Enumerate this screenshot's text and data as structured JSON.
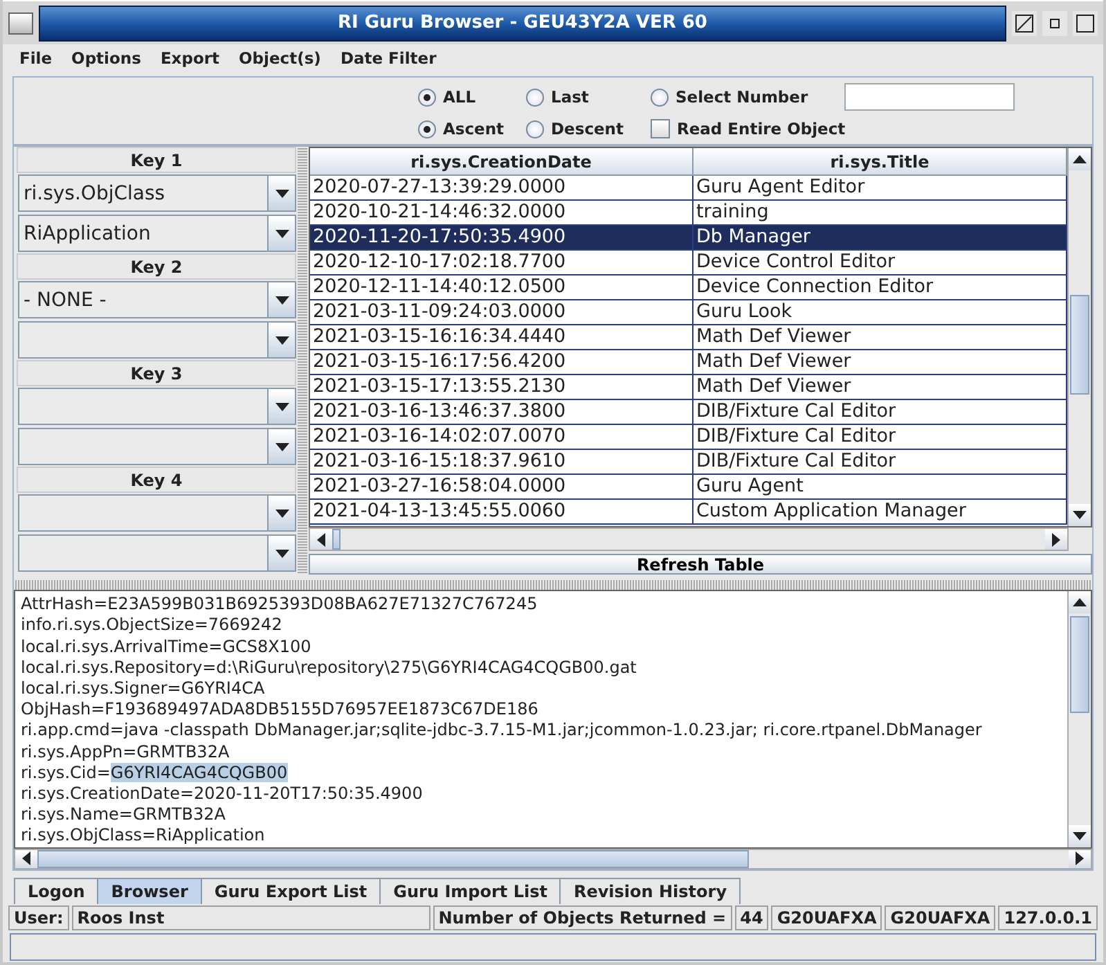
{
  "window": {
    "title": "RI Guru Browser - GEU43Y2A  VER 60"
  },
  "menu": [
    "File",
    "Options",
    "Export",
    "Object(s)",
    "Date Filter"
  ],
  "options": {
    "count_radios": [
      {
        "label": "ALL",
        "selected": true
      },
      {
        "label": "Last",
        "selected": false
      },
      {
        "label": "Select Number",
        "selected": false
      }
    ],
    "order_radios": [
      {
        "label": "Ascent",
        "selected": true
      },
      {
        "label": "Descent",
        "selected": false
      }
    ],
    "read_entire": {
      "label": "Read Entire Object",
      "checked": false
    }
  },
  "keys": [
    {
      "label": "Key 1",
      "fields": [
        {
          "kind": "combo",
          "value": "ri.sys.ObjClass"
        },
        {
          "kind": "combo",
          "value": "RiApplication"
        }
      ]
    },
    {
      "label": "Key 2",
      "fields": [
        {
          "kind": "combo",
          "value": "- NONE -"
        },
        {
          "kind": "combo"
        }
      ]
    },
    {
      "label": "Key 3",
      "fields": [
        {
          "kind": "combo"
        },
        {
          "kind": "combo"
        }
      ]
    },
    {
      "label": "Key 4",
      "fields": [
        {
          "kind": "combo"
        },
        {
          "kind": "combo"
        }
      ]
    }
  ],
  "table": {
    "columns": [
      "ri.sys.CreationDate",
      "ri.sys.Title"
    ],
    "rows": [
      {
        "date": "2020-07-27-13:39:29.0000",
        "title": "Guru Agent Editor",
        "selected": false
      },
      {
        "date": "2020-10-21-14:46:32.0000",
        "title": "training",
        "selected": false
      },
      {
        "date": "2020-11-20-17:50:35.4900",
        "title": "Db Manager",
        "selected": true
      },
      {
        "date": "2020-12-10-17:02:18.7700",
        "title": "Device Control Editor",
        "selected": false
      },
      {
        "date": "2020-12-11-14:40:12.0500",
        "title": "Device Connection Editor",
        "selected": false
      },
      {
        "date": "2021-03-11-09:24:03.0000",
        "title": "Guru Look",
        "selected": false
      },
      {
        "date": "2021-03-15-16:16:34.4440",
        "title": "Math Def Viewer",
        "selected": false
      },
      {
        "date": "2021-03-15-16:17:56.4200",
        "title": "Math Def Viewer",
        "selected": false
      },
      {
        "date": "2021-03-15-17:13:55.2130",
        "title": "Math Def Viewer",
        "selected": false
      },
      {
        "date": "2021-03-16-13:46:37.3800",
        "title": "DIB/Fixture Cal Editor",
        "selected": false
      },
      {
        "date": "2021-03-16-14:02:07.0070",
        "title": "DIB/Fixture Cal Editor",
        "selected": false
      },
      {
        "date": "2021-03-16-15:18:37.9610",
        "title": "DIB/Fixture Cal Editor",
        "selected": false
      },
      {
        "date": "2021-03-27-16:58:04.0000",
        "title": "Guru Agent",
        "selected": false
      },
      {
        "date": "2021-04-13-13:45:55.0060",
        "title": "Custom Application Manager",
        "selected": false
      }
    ]
  },
  "refresh_button": "Refresh Table",
  "details": [
    {
      "text": "AttrHash=E23A599B031B6925393D08BA627E71327C767245"
    },
    {
      "text": "info.ri.sys.ObjectSize=7669242"
    },
    {
      "text": "local.ri.sys.ArrivalTime=GCS8X100"
    },
    {
      "text": "local.ri.sys.Repository=d:\\RiGuru\\repository\\275\\G6YRI4CAG4CQGB00.gat"
    },
    {
      "text": "local.ri.sys.Signer=G6YRI4CA"
    },
    {
      "text": "ObjHash=F193689497ADA8DB5155D76957EE1873C67DE186"
    },
    {
      "text": "ri.app.cmd=java -classpath DbManager.jar;sqlite-jdbc-3.7.15-M1.jar;jcommon-1.0.23.jar;  ri.core.rtpanel.DbManager"
    },
    {
      "text": "ri.sys.AppPn=GRMTB32A"
    },
    {
      "text": "ri.sys.Cid=",
      "highlight": "G6YRI4CAG4CQGB00"
    },
    {
      "text": "ri.sys.CreationDate=2020-11-20T17:50:35.4900"
    },
    {
      "text": "ri.sys.Name=GRMTB32A"
    },
    {
      "text": "ri.sys.ObjClass=RiApplication"
    }
  ],
  "tabs": [
    {
      "label": "Logon",
      "selected": false
    },
    {
      "label": "Browser",
      "selected": true
    },
    {
      "label": "Guru Export List",
      "selected": false
    },
    {
      "label": "Guru Import List",
      "selected": false
    },
    {
      "label": "Revision History",
      "selected": false
    }
  ],
  "status": {
    "user_label": "User:",
    "user": "Roos Inst",
    "count_label": "Number of Objects Returned =",
    "count": "44",
    "fields": [
      "G20UAFXA",
      "G20UAFXA",
      "127.0.0.1"
    ]
  }
}
